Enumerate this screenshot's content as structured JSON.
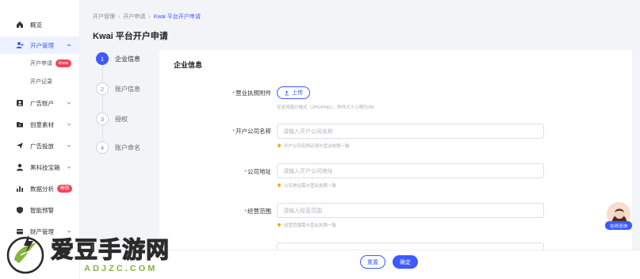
{
  "sidebar": {
    "items": [
      {
        "label": "概览",
        "icon": "home-icon"
      },
      {
        "label": "开户管理",
        "icon": "user-add-icon",
        "expanded": true
      },
      {
        "label": "广告账户",
        "icon": "account-icon"
      },
      {
        "label": "创意素材",
        "icon": "folder-icon"
      },
      {
        "label": "广告投放",
        "icon": "send-icon"
      },
      {
        "label": "黑科技宝箱",
        "icon": "user-icon"
      },
      {
        "label": "数据分析",
        "icon": "bar-chart-icon",
        "badge": "畅销"
      },
      {
        "label": "智能预警",
        "icon": "shield-icon"
      },
      {
        "label": "财产管理",
        "icon": "wallet-icon"
      }
    ],
    "sub_items": [
      {
        "label": "开户申请",
        "badge": "Kwai"
      },
      {
        "label": "开户记录"
      }
    ]
  },
  "header": {
    "breadcrumb": [
      "开户管理",
      "开户申请",
      "Kwai 平台开户申请"
    ],
    "title": "Kwai 平台开户申请"
  },
  "steps": [
    {
      "num": "1",
      "label": "企业信息",
      "active": true
    },
    {
      "num": "2",
      "label": "账户信息"
    },
    {
      "num": "3",
      "label": "授权"
    },
    {
      "num": "4",
      "label": "账户命名"
    }
  ],
  "form": {
    "section_title": "企业信息",
    "license": {
      "label": "营业执照附件",
      "button": "上传",
      "hint": "仅支持图片格式（JPG/PNG），附件大小上限为2M"
    },
    "company_name": {
      "label": "开户公司名称",
      "placeholder": "请输入开户公司名称",
      "hint": "开户公司名称必须与营业执照一致"
    },
    "company_address": {
      "label": "公司地址",
      "placeholder": "请输入开户公司地址",
      "hint": "公司地址需与营业执照一致"
    },
    "business_scope": {
      "label": "经营范围",
      "placeholder": "请输入经营范围",
      "hint": "经营范围需与营业执照一致"
    }
  },
  "footer": {
    "reset": "重置",
    "confirm": "确定"
  },
  "chat": {
    "label": "在线咨询"
  },
  "watermark": {
    "name": "爱豆手游网",
    "domain": "ADJZC.COM"
  },
  "colors": {
    "accent": "#3d5afe",
    "badge": "#f0465a",
    "watermark_green": "#86b43d"
  }
}
